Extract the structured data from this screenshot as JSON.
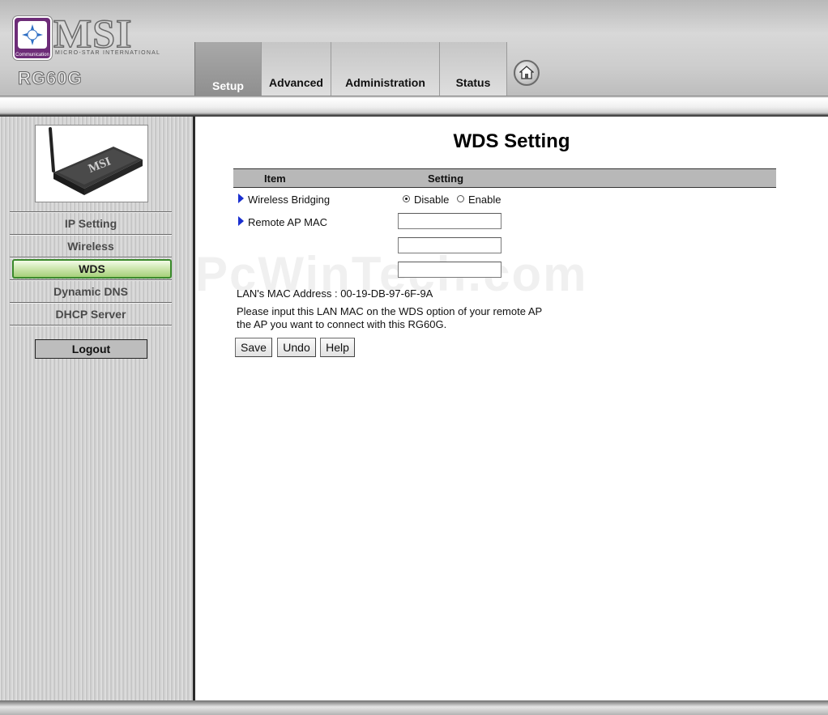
{
  "header": {
    "brand": "MSI",
    "brand_sub": "MICRO-STAR INTERNATIONAL",
    "logo_badge": "Communication",
    "model": "RG60G",
    "tabs": [
      {
        "label": "Setup",
        "active": true
      },
      {
        "label": "Advanced",
        "active": false
      },
      {
        "label": "Administration",
        "active": false
      },
      {
        "label": "Status",
        "active": false
      }
    ],
    "home_icon": "home-icon"
  },
  "sidebar": {
    "menu": [
      {
        "label": "IP Setting",
        "active": false
      },
      {
        "label": "Wireless",
        "active": false
      },
      {
        "label": "WDS",
        "active": true
      },
      {
        "label": "Dynamic DNS",
        "active": false
      },
      {
        "label": "DHCP Server",
        "active": false
      }
    ],
    "logout_label": "Logout",
    "active_color": "#3b8a2c"
  },
  "main": {
    "title": "WDS Setting",
    "table_header": {
      "item": "Item",
      "setting": "Setting"
    },
    "wireless_bridging": {
      "label": "Wireless Bridging",
      "options": [
        "Disable",
        "Enable"
      ],
      "selected": "Disable"
    },
    "remote_ap_mac": {
      "label": "Remote AP MAC",
      "values": [
        "",
        "",
        ""
      ]
    },
    "lan_mac": "LAN's MAC Address : 00-19-DB-97-6F-9A",
    "note_line1": "Please input this LAN MAC on the WDS option of your remote AP",
    "note_line2": "the AP you want to connect with this RG60G.",
    "buttons": {
      "save": "Save",
      "undo": "Undo",
      "help": "Help"
    },
    "watermark": "PcWinTech.com",
    "arrow_color": "#1a2fd0"
  }
}
